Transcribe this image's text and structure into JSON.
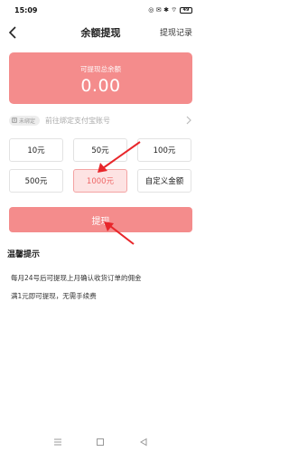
{
  "status_bar": {
    "time": "15:09",
    "icons_text": "◎ ✉ ✱ ⌔ ",
    "battery": "49"
  },
  "header": {
    "title": "余额提现",
    "records_label": "提现记录"
  },
  "balance": {
    "label": "可提现总余额",
    "value": "0.00"
  },
  "account": {
    "badge": "未绑定",
    "badge_icon": "支",
    "hint": "前往绑定支付宝账号"
  },
  "amounts": [
    {
      "label": "10元",
      "selected": false
    },
    {
      "label": "50元",
      "selected": false
    },
    {
      "label": "100元",
      "selected": false
    },
    {
      "label": "500元",
      "selected": false
    },
    {
      "label": "1000元",
      "selected": true
    },
    {
      "label": "自定义金额",
      "selected": false
    }
  ],
  "submit_label": "提现",
  "tips": {
    "title": "温馨提示",
    "line1": "每月24号后可提现上月确认收货订单的佣金",
    "line2": "满1元即可提现，无需手续费"
  },
  "colors": {
    "accent": "#f48c8c",
    "selected_bg": "#fde3e3",
    "arrow": "#e8262a"
  }
}
